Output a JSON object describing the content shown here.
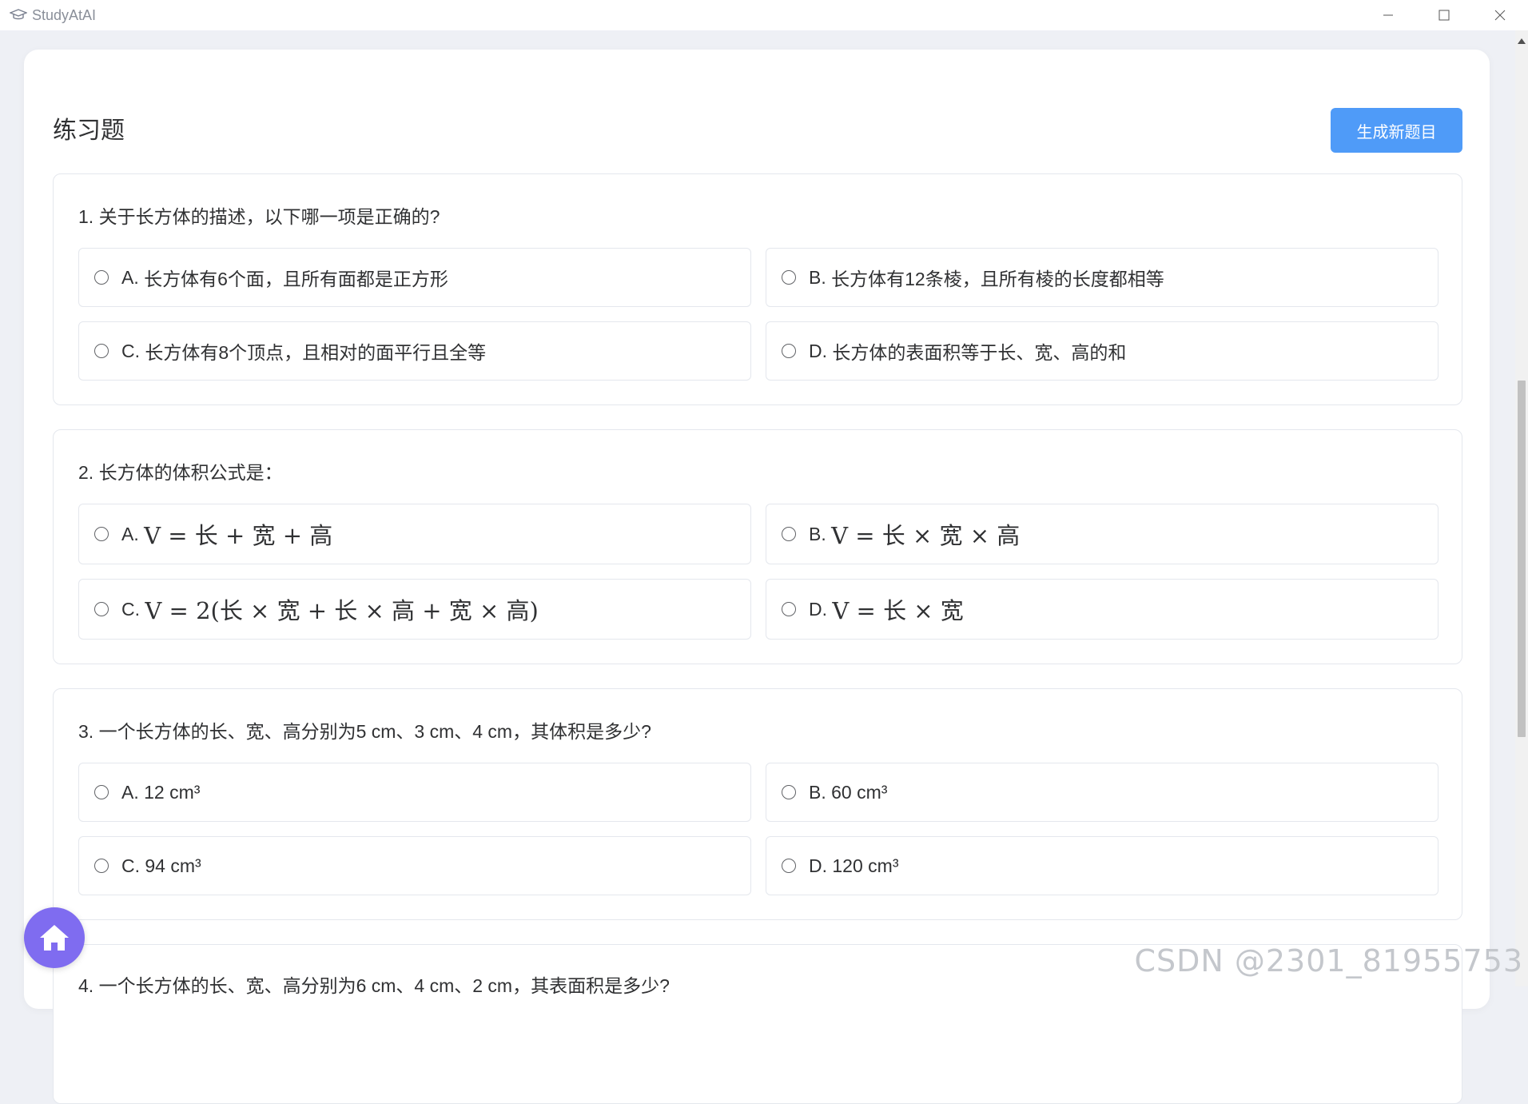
{
  "window": {
    "app_title": "StudyAtAI"
  },
  "header": {
    "title": "练习题",
    "generate_button": "生成新题目"
  },
  "questions": [
    {
      "text": "1. 关于长方体的描述，以下哪一项是正确的?",
      "options": [
        {
          "letter": "A. ",
          "text": "长方体有6个面，且所有面都是正方形"
        },
        {
          "letter": "B. ",
          "text": "长方体有12条棱，且所有棱的长度都相等"
        },
        {
          "letter": "C. ",
          "text": "长方体有8个顶点，且相对的面平行且全等"
        },
        {
          "letter": "D. ",
          "text": "长方体的表面积等于长、宽、高的和"
        }
      ]
    },
    {
      "text": "2. 长方体的体积公式是：",
      "options": [
        {
          "letter": "A. ",
          "text": "V = 长 + 宽 + 高"
        },
        {
          "letter": "B. ",
          "text": "V = 长 × 宽 × 高"
        },
        {
          "letter": "C. ",
          "text": "V = 2(长 × 宽 + 长 × 高 + 宽 × 高)"
        },
        {
          "letter": "D. ",
          "text": "V = 长 × 宽"
        }
      ]
    },
    {
      "text": "3. 一个长方体的长、宽、高分别为5 cm、3 cm、4 cm，其体积是多少?",
      "options": [
        {
          "letter": "A. ",
          "text": "12 cm³"
        },
        {
          "letter": "B. ",
          "text": "60 cm³"
        },
        {
          "letter": "C. ",
          "text": "94 cm³"
        },
        {
          "letter": "D. ",
          "text": "120 cm³"
        }
      ]
    },
    {
      "text": "4. 一个长方体的长、宽、高分别为6 cm、4 cm、2 cm，其表面积是多少?"
    }
  ],
  "watermark": "CSDN @2301_81955753",
  "colors": {
    "primary_button": "#4f9bf8",
    "home_fab": "#7f6cf0",
    "background": "#eef0f5"
  },
  "icons": {
    "app_logo": "graduation-cap-icon",
    "minimize": "minimize-icon",
    "maximize": "maximize-icon",
    "close": "close-icon",
    "home": "home-icon"
  }
}
